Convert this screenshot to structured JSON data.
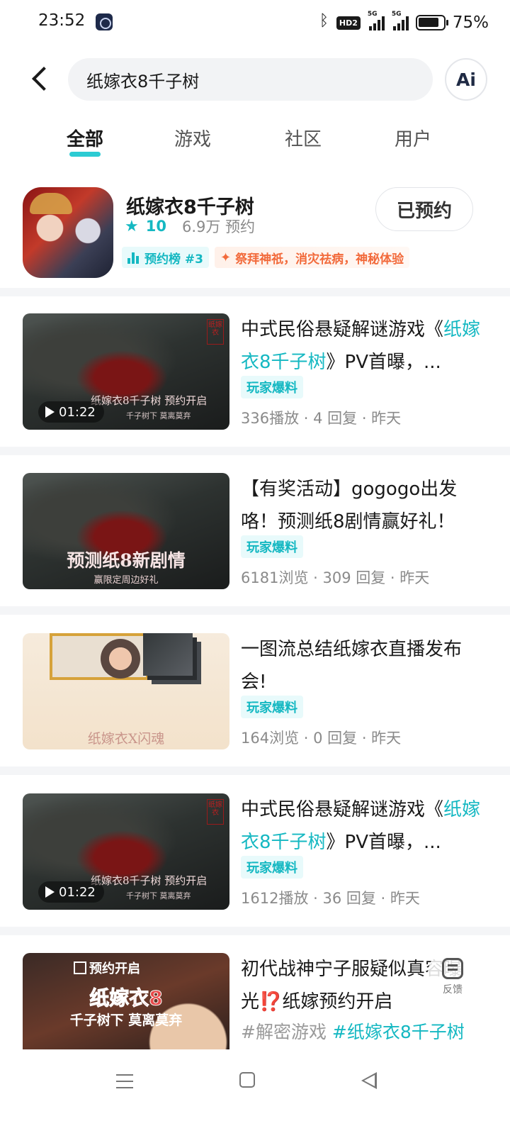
{
  "status_bar": {
    "time": "23:52",
    "hd_badge": "HD2",
    "signal1_label": "5G",
    "signal2_label": "5G",
    "battery": "75%"
  },
  "search": {
    "query": "纸嫁衣8千子树",
    "ai_label": "Ai"
  },
  "tabs": [
    {
      "label": "全部",
      "active": true
    },
    {
      "label": "游戏",
      "active": false
    },
    {
      "label": "社区",
      "active": false
    },
    {
      "label": "用户",
      "active": false
    }
  ],
  "game": {
    "title": "纸嫁衣8千子树",
    "score": "10",
    "reservations": "6.9万 预约",
    "rank_tag": "预约榜 #3",
    "feature_tag": "祭拜神祇，消灾祛病，神秘体验",
    "action_label": "已预约"
  },
  "posts": [
    {
      "thumb_text_main": "纸嫁衣8千子树  预约开启",
      "thumb_text_sub": "千子树下  莫离莫弃",
      "seal": "纸嫁衣",
      "duration": "01:22",
      "title_before": "中式民俗悬疑解谜游戏《",
      "title_highlight": "纸嫁衣8千子树",
      "title_after": "》PV首曝，...",
      "tag": "玩家爆料",
      "stats": "336播放 · 4 回复 · 昨天"
    },
    {
      "thumb_text_main": "预测纸8新剧情",
      "thumb_text_sub": "赢限定周边好礼",
      "title": "【有奖活动】gogogo出发咯！预测纸8剧情赢好礼！",
      "tag": "玩家爆料",
      "stats": "6181浏览 · 309 回复 · 昨天"
    },
    {
      "thumb_text_main": "纸嫁衣X闪魂",
      "title": "一图流总结纸嫁衣直播发布会!",
      "tag": "玩家爆料",
      "stats": "164浏览 · 0 回复 · 昨天"
    },
    {
      "thumb_text_main": "纸嫁衣8千子树  预约开启",
      "thumb_text_sub": "千子树下  莫离莫弃",
      "seal": "纸嫁衣",
      "duration": "01:22",
      "title_before": "中式民俗悬疑解谜游戏《",
      "title_highlight": "纸嫁衣8千子树",
      "title_after": "》PV首曝，...",
      "tag": "玩家爆料",
      "stats": "1612播放 · 36 回复 · 昨天"
    },
    {
      "thumb_line1": "预约开启",
      "thumb_line2": "纸嫁衣8",
      "thumb_line3": "千子树下 莫离莫弃",
      "title": "初代战神宁子服疑似真容曝光⁉️纸嫁预约开启",
      "hashtag1": "#解密游戏",
      "hashtag2": "#纸嫁衣8千子树"
    }
  ],
  "feedback_label": "反馈",
  "colors": {
    "accent": "#15b8c2",
    "feature_tag": "#f26a3b",
    "muted_text": "#8a8a8a"
  }
}
